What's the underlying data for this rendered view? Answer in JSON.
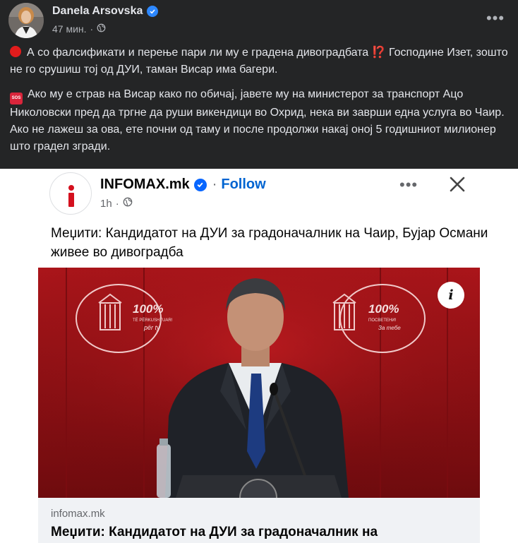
{
  "post": {
    "author": "Danela Arsovska",
    "time": "47 мин.",
    "paragraph1": "А со фалсификати и перење пари ли му е градена дивоградбата",
    "paragraph1_tail": "Господине Изет, зошто не го срушиш тој од ДУИ, таман Висар има багери.",
    "paragraph2": "Ако му е страв на Висар како по обичај, јавете му на министерот за транспорт Ацо Николовски пред да тргне да руши викендици во Охрид, нека ви заврши една услуга во Чаир. Ако не лажеш за ова, ете почни од таму и после продолжи накај оној 5 годишниот милионер што градел згради.",
    "emoji_q": "⁉️",
    "emoji_sos": "SOS"
  },
  "shared": {
    "page_name": "INFOMAX.mk",
    "separator": "·",
    "follow_label": "Follow",
    "time": "1h",
    "text": "Меџити: Кандидатот на ДУИ за градоначалник на Чаир, Бујар Османи живее во дивоградба",
    "info_label": "i",
    "link_domain": "infomax.mk",
    "link_title": "Меџити: Кандидатот на ДУИ за градоначалник на"
  },
  "photo_content": {
    "banner_percent": "100%",
    "banner_left_line1": "TË PËRKUSHTUAR!",
    "banner_left_line2": "për ty",
    "banner_right_line1": "ПОСВЕТЕНИ!",
    "banner_right_line2": "За тебе"
  },
  "colors": {
    "background": "#242526",
    "accent_blue": "#2d88ff",
    "follow_blue": "#0064d1",
    "backdrop_red": "#a5151a"
  },
  "icons": [
    "verified-badge-icon",
    "globe-icon",
    "more-options-icon",
    "close-icon",
    "info-icon",
    "red-circle-emoji",
    "sos-emoji",
    "interrobang-emoji"
  ]
}
